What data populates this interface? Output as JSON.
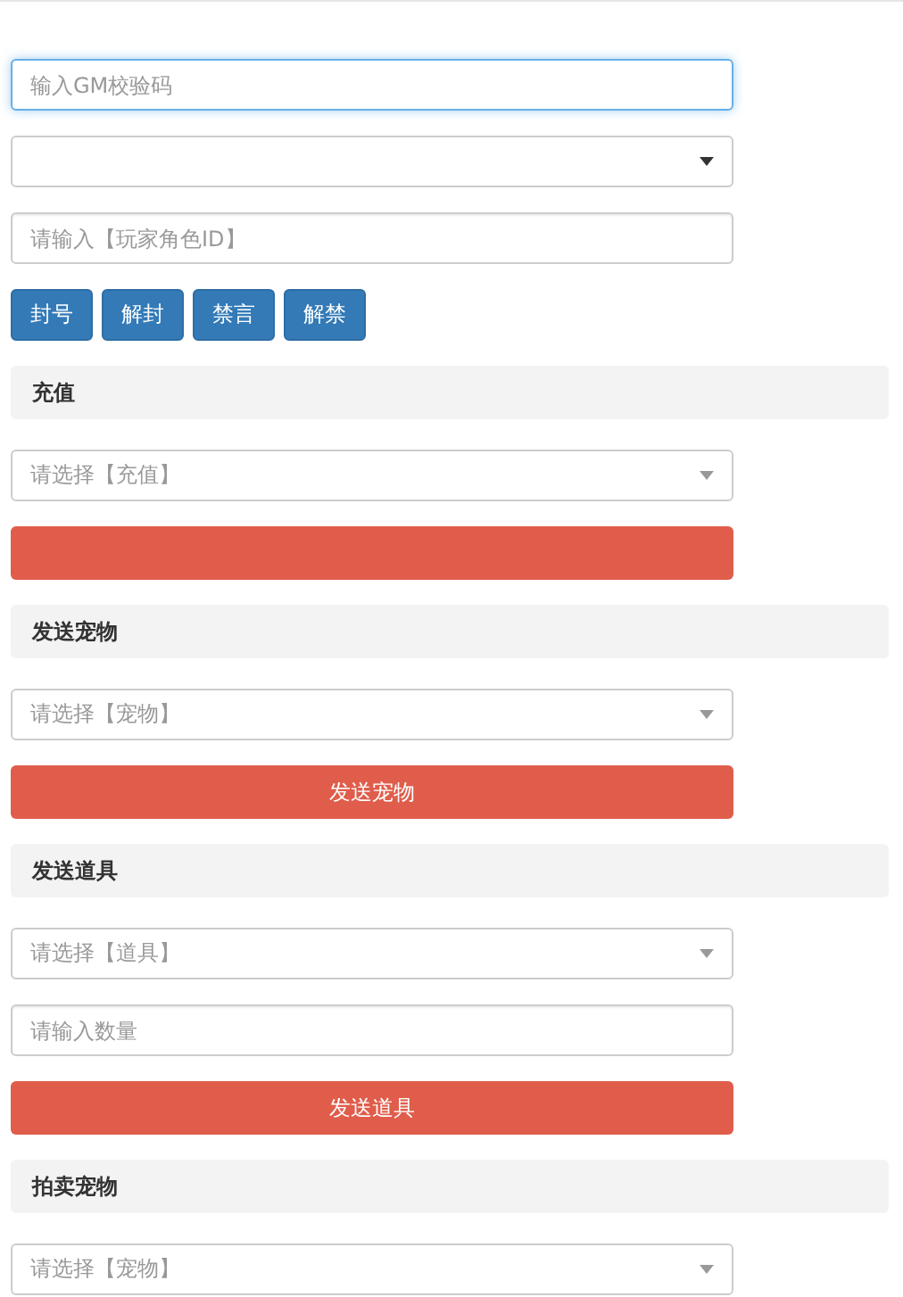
{
  "controls": [
    {
      "kind": "input",
      "placeholder": "输入GM校验码",
      "focused": true
    },
    {
      "kind": "select"
    },
    {
      "kind": "input",
      "placeholder": "请输入【玩家角色ID】",
      "focused": false
    },
    {
      "kind": "buttons",
      "buttons": [
        "封号",
        "解封",
        "禁言",
        "解禁"
      ]
    }
  ],
  "sections": [
    {
      "title": "充值",
      "items": [
        {
          "kind": "select",
          "placeholder": "请选择【充值】"
        },
        {
          "kind": "submit"
        }
      ]
    },
    {
      "title": "发送宠物",
      "items": [
        {
          "kind": "select",
          "placeholder": "请选择【宠物】"
        },
        {
          "kind": "submit",
          "label": "发送宠物"
        }
      ]
    },
    {
      "title": "发送道具",
      "items": [
        {
          "kind": "select",
          "placeholder": "请选择【道具】"
        },
        {
          "kind": "input",
          "placeholder": "请输入数量",
          "focused": false
        },
        {
          "kind": "submit",
          "label": "发送道具"
        }
      ]
    },
    {
      "title": "拍卖宠物",
      "items": [
        {
          "kind": "select",
          "placeholder": "请选择【宠物】"
        }
      ]
    }
  ]
}
